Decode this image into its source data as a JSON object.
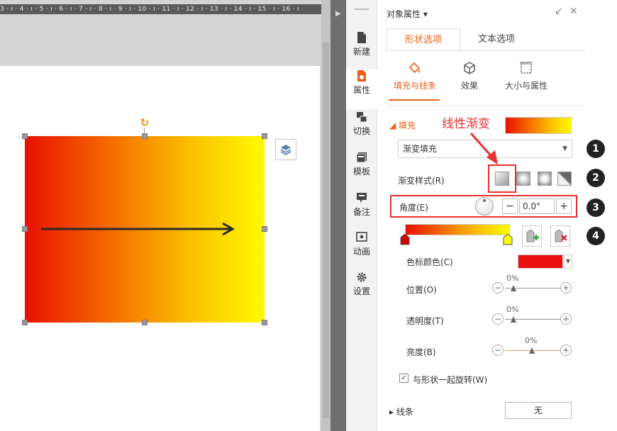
{
  "ruler": {
    "text": "3 · ı · 4 · ı · 5 · ı · 6 · ı · 7 · ı · 8 · ı · 9 · ı · 10 · ı · 11 · ı · 12 · ı · 13 · ı · 14 · ı · 15 · ı · 16 · ı"
  },
  "sidenav": {
    "items": [
      {
        "label": "新建",
        "icon": "file-icon"
      },
      {
        "label": "属性",
        "icon": "properties-icon",
        "active": true
      },
      {
        "label": "切换",
        "icon": "switch-icon"
      },
      {
        "label": "模板",
        "icon": "template-icon"
      },
      {
        "label": "备注",
        "icon": "note-icon"
      },
      {
        "label": "动画",
        "icon": "animation-icon"
      },
      {
        "label": "设置",
        "icon": "gear-icon"
      }
    ]
  },
  "panel": {
    "title": "对象属性 ▾",
    "pin_symbol": "↙",
    "close_symbol": "✕",
    "tabs": [
      {
        "label": "形状选项",
        "active": true
      },
      {
        "label": "文本选项"
      }
    ],
    "subtabs": [
      {
        "label": "填充与线条",
        "active": true
      },
      {
        "label": "效果"
      },
      {
        "label": "大小与属性"
      }
    ]
  },
  "fill": {
    "header": "◢ 填充",
    "annotation": "线性渐变",
    "type_value": "渐变填充",
    "gradient_style_label": "渐变样式(R)",
    "angle_label": "角度(E)",
    "angle_value": "0.0°",
    "minus": "−",
    "plus": "+",
    "color_label": "色标颜色(C)",
    "color_value": "#e81010",
    "position_label": "位置(O)",
    "position_pct": "0%",
    "transparency_label": "透明度(T)",
    "transparency_pct": "0%",
    "brightness_label": "亮度(B)",
    "brightness_pct": "0%",
    "rotate_label": "与形状一起旋转(W)",
    "rotate_checked": true
  },
  "steps": [
    "1",
    "2",
    "3",
    "4"
  ],
  "line": {
    "header": "▸ 线条",
    "value": "无"
  },
  "colors": {
    "accent": "#e8601a",
    "annotation_red": "#e83030",
    "gradient": [
      "#e81000",
      "#f46a00",
      "#fbc200",
      "#fffb00"
    ]
  }
}
